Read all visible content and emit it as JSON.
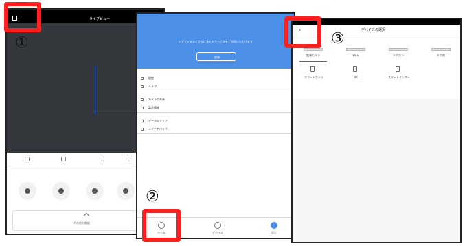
{
  "annotations": {
    "step1": "①",
    "step2": "②",
    "step3": "③"
  },
  "screen1": {
    "title": "ライブビュー",
    "footer_label": "その他の機能"
  },
  "screen2": {
    "hero_text": "ログインするとさらに多くのサービスをご利用いただけます",
    "hero_button": "登録",
    "menu_sections": [
      [
        "設定",
        "ヘルプ"
      ],
      [
        "カメラの共有",
        "製品情報"
      ],
      [
        "データのクリア",
        "フィードバック"
      ]
    ],
    "tabs": [
      "ホーム",
      "デバイス",
      "設定"
    ]
  },
  "screen3": {
    "back": "<",
    "title": "デバイスの選択",
    "tabs": [
      "監視カメラ",
      "Wi-Fi",
      "ドアホン",
      "その他"
    ],
    "items": [
      "スマートカメラ",
      "IPC",
      "スマートセンサー"
    ]
  },
  "colors": {
    "highlight": "#ff1f1f",
    "hero": "#4c90e8",
    "camera_bg": "#34383d"
  }
}
